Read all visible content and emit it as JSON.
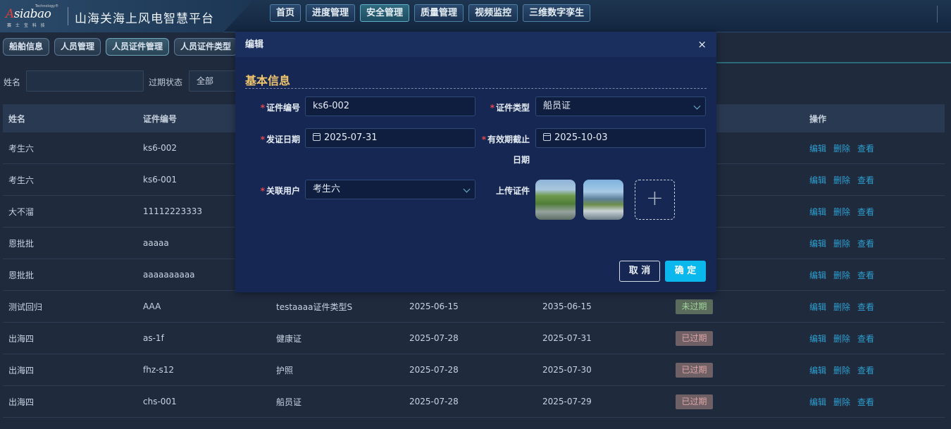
{
  "header": {
    "logo_text_a": "A",
    "logo_text_rest": "siabao",
    "logo_sub": "赛 士 宝 科 技",
    "logo_super": "Technology®",
    "title": "山海关海上风电智慧平台",
    "nav": [
      {
        "label": "首页"
      },
      {
        "label": "进度管理"
      },
      {
        "label": "安全管理",
        "active": true
      },
      {
        "label": "质量管理"
      },
      {
        "label": "视频监控"
      },
      {
        "label": "三维数字孪生"
      }
    ]
  },
  "tabs": [
    {
      "label": "船舶信息"
    },
    {
      "label": "人员管理"
    },
    {
      "label": "人员证件管理",
      "active": true
    },
    {
      "label": "人员证件类型"
    }
  ],
  "filters": {
    "name_label": "姓名",
    "name_value": "",
    "status_label": "过期状态",
    "status_value": "全部"
  },
  "table": {
    "headers": {
      "name": "姓名",
      "cert_no": "证件编号",
      "actions": "操作"
    },
    "rows": [
      {
        "name": "考生六",
        "cert_no": "ks6-002",
        "type": "",
        "issue": "",
        "expire": "",
        "status": ""
      },
      {
        "name": "考生六",
        "cert_no": "ks6-001",
        "type": "",
        "issue": "",
        "expire": "",
        "status": ""
      },
      {
        "name": "大不溜",
        "cert_no": "11112223333",
        "type": "",
        "issue": "",
        "expire": "",
        "status": ""
      },
      {
        "name": "恩批批",
        "cert_no": "aaaaa",
        "type": "",
        "issue": "",
        "expire": "",
        "status": ""
      },
      {
        "name": "恩批批",
        "cert_no": "aaaaaaaaaa",
        "type": "",
        "issue": "",
        "expire": "",
        "status": ""
      },
      {
        "name": "测试回归",
        "cert_no": "AAA",
        "type": "testaaaa证件类型S",
        "issue": "2025-06-15",
        "expire": "2035-06-15",
        "status": "未过期"
      },
      {
        "name": "出海四",
        "cert_no": "as-1f",
        "type": "健康证",
        "issue": "2025-07-28",
        "expire": "2025-07-31",
        "status": "已过期"
      },
      {
        "name": "出海四",
        "cert_no": "fhz-s12",
        "type": "护照",
        "issue": "2025-07-28",
        "expire": "2025-07-30",
        "status": "已过期"
      },
      {
        "name": "出海四",
        "cert_no": "chs-001",
        "type": "船员证",
        "issue": "2025-07-28",
        "expire": "2025-07-29",
        "status": "已过期"
      }
    ],
    "action_edit": "编辑",
    "action_delete": "删除",
    "action_view": "查看"
  },
  "modal": {
    "title": "编辑",
    "close": "×",
    "section": "基本信息",
    "cert_no_label": "证件编号",
    "cert_no_value": "ks6-002",
    "cert_type_label": "证件类型",
    "cert_type_value": "船员证",
    "issue_label": "发证日期",
    "issue_value": "2025-07-31",
    "expire_label_1": "有效期截止",
    "expire_label_2": "日期",
    "expire_value": "2025-10-03",
    "user_label": "关联用户",
    "user_value": "考生六",
    "upload_label": "上传证件",
    "upload_plus": "+",
    "required_mark": "*",
    "cancel": "取 消",
    "confirm": "确 定"
  },
  "colors": {
    "accent": "#0bb8ee",
    "section_title": "#f2c66d",
    "required": "#e5484d",
    "link": "#2e9fd0"
  }
}
